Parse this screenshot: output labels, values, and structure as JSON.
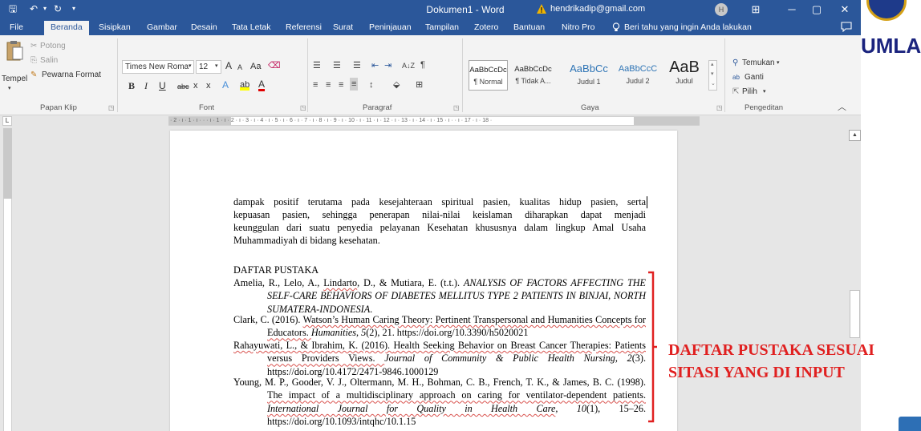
{
  "titlebar": {
    "doc_title": "Dokumen1  -  Word",
    "account_email": "hendrikadip@gmail.com",
    "avatar_initial": "H",
    "save_glyph": "🖫",
    "undo_glyph": "↶",
    "redo_glyph": "↻",
    "customize_glyph": "▾",
    "minimize_glyph": "─",
    "restore_glyph": "▢",
    "close_glyph": "✕",
    "ribbon_display_glyph": "⊞"
  },
  "tabs": [
    "File",
    "Beranda",
    "Sisipkan",
    "Gambar",
    "Desain",
    "Tata Letak",
    "Referensi",
    "Surat",
    "Peninjauan",
    "Tampilan",
    "Zotero",
    "Bantuan",
    "Nitro Pro"
  ],
  "active_tab": "Beranda",
  "tell_me": "Beri tahu yang ingin Anda lakukan",
  "ribbon": {
    "clipboard": {
      "paste": "Tempel",
      "cut": "Potong",
      "copy": "Salin",
      "format_painter": "Pewarna Format",
      "label": "Papan Klip"
    },
    "font": {
      "font_name": "Times New Roma",
      "font_size": "12",
      "grow": "A",
      "shrink": "A",
      "change_case": "Aa",
      "bold": "B",
      "italic": "I",
      "underline": "U",
      "strikethrough": "abc",
      "subscript": "x",
      "superscript": "x",
      "font_color": "A",
      "label": "Font"
    },
    "paragraph": {
      "label": "Paragraf",
      "sort": "A↓Z",
      "pilcrow": "¶"
    },
    "styles": {
      "label": "Gaya",
      "items": [
        {
          "preview": "AaBbCcDc",
          "name": "¶ Normal"
        },
        {
          "preview": "AaBbCcDc",
          "name": "¶ Tidak A..."
        },
        {
          "preview": "AaBbCc",
          "name": "Judul 1"
        },
        {
          "preview": "AaBbCcC",
          "name": "Judul 2"
        },
        {
          "preview": "AaB",
          "name": "Judul"
        }
      ]
    },
    "editing": {
      "find": "Temukan",
      "replace": "Ganti",
      "select": "Pilih",
      "label": "Pengeditan"
    }
  },
  "ruler_text": "· 2 · ı · 1 · ı ·  ·  · ı · 1 · ı · 2 · ı · 3 · ı · 4 · ı · 5 · ı · 6 · ı · 7 · ı · 8 · ı · 9 · ı · 10 · ı · 11 · ı · 12 · ı · 13 · ı · 14 · ı · 15 · ı ·  · ı · 17 · ı · 18 ·",
  "document": {
    "para_lines": [
      "dampak positif terutama pada kesejahteraan spiritual pasien, kualitas hidup pasien, serta",
      "kepuasan pasien, sehingga penerapan nilai-nilai keislaman diharapkan dapat menjadi",
      "keunggulan dari suatu penyedia pelayanan Kesehatan khususnya dalam lingkup Amal Usaha"
    ],
    "para_last": "Muhammadiyah di bidang kesehatan.",
    "heading": "DAFTAR PUSTAKA",
    "refs": [
      {
        "authors_a": "Amelia, R., Lelo, A., ",
        "authors_sq": "Lindarto",
        "authors_b": ", D., & Mutiara, E. (t.t.). ",
        "title_italic": "ANALYSIS OF FACTORS AFFECTING THE SELF-CARE BEHAVIORS OF DIABETES MELLITUS TYPE 2 PATIENTS IN BINJAI, NORTH SUMATERA-INDONESIA",
        "tail": "."
      },
      {
        "authors": "Clark, C. (2016). ",
        "title": "Watson’s Human Caring Theory: Pertinent Transpersonal and Humanities Concepts for Educators. ",
        "journal_italic": "Humanities",
        "vol": ", 5",
        "rest": "(2), 21. https://doi.org/10.3390/h5020021"
      },
      {
        "authors": "Rahayuwati, L., & Ibrahim, K. (2016). ",
        "title": "Health Seeking Behavior on Breast Cancer Therapies: Patients versus Providers Views. ",
        "journal_italic": "Journal of Community & Public Health Nursing",
        "vol": ", 2",
        "rest": "(3). https://doi.org/10.4172/2471-9846.1000129"
      },
      {
        "authors": "Young, M. P., Gooder, V. J., Oltermann, M. H., Bohman, C. B., French, T. K., & James, B. C. (1998). ",
        "title": "The impact of a multidisciplinary approach on caring for ventilator-dependent patients. ",
        "journal_italic": "International Journal for Quality in Health Care",
        "vol": ", 10",
        "rest": "(1), 15–26. https://doi.org/10.1093/intqhc/10.1.15"
      }
    ]
  },
  "annotation": {
    "line1": "DAFTAR PUSTAKA SESUAI",
    "line2": "SITASI YANG DI INPUT",
    "color": "#e02020"
  },
  "logo_text": "UMLA",
  "colors": {
    "word_blue": "#2b579a",
    "annotation_red": "#e02020"
  }
}
